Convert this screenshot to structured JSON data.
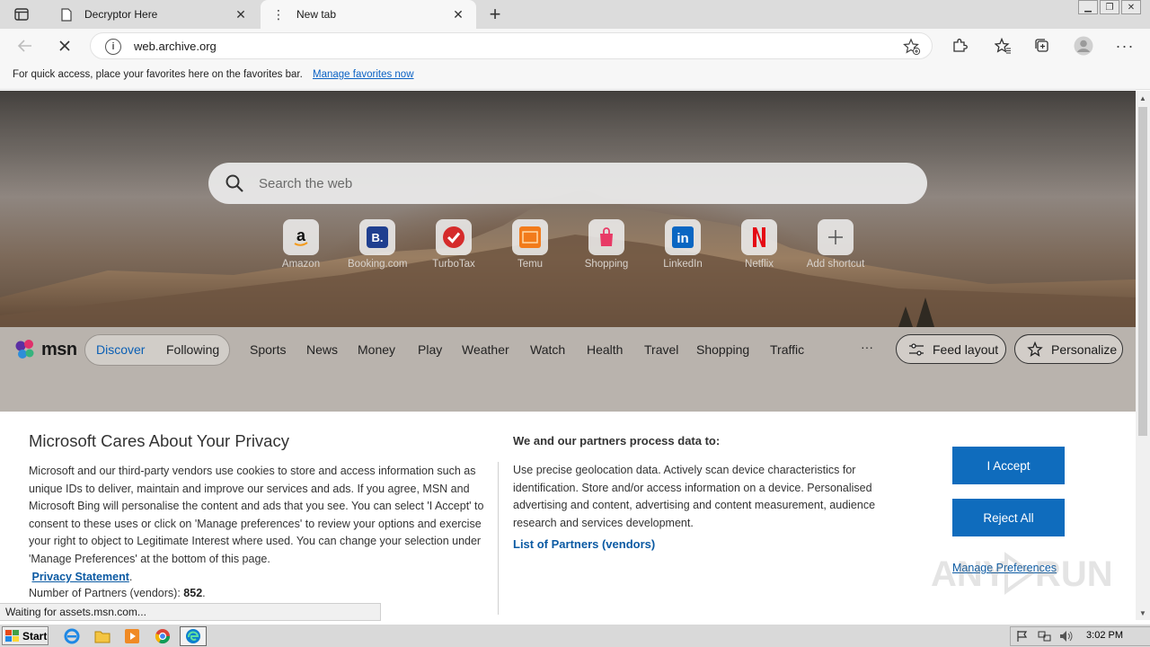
{
  "tabs": [
    {
      "title": "Decryptor Here",
      "active": false
    },
    {
      "title": "New tab",
      "active": true
    }
  ],
  "address": {
    "url": "web.archive.org"
  },
  "favorites_bar": {
    "hint": "For quick access, place your favorites here on the favorites bar.",
    "link": "Manage favorites now"
  },
  "search": {
    "placeholder": "Search the web"
  },
  "shortcuts": [
    {
      "label": "Amazon",
      "icon": "amazon-icon"
    },
    {
      "label": "Booking.com",
      "icon": "booking-icon"
    },
    {
      "label": "TurboTax",
      "icon": "turbotax-icon"
    },
    {
      "label": "Temu",
      "icon": "temu-icon"
    },
    {
      "label": "Shopping",
      "icon": "shopping-bag-icon"
    },
    {
      "label": "LinkedIn",
      "icon": "linkedin-icon"
    },
    {
      "label": "Netflix",
      "icon": "netflix-icon"
    },
    {
      "label": "Add shortcut",
      "icon": "plus-icon"
    }
  ],
  "msn": {
    "logo_text": "msn",
    "feed_tabs": [
      "Discover",
      "Following"
    ],
    "nav": [
      "Sports",
      "News",
      "Money",
      "Play",
      "Weather",
      "Watch",
      "Health",
      "Travel",
      "Shopping",
      "Traffic"
    ],
    "more": "···",
    "feed_layout": "Feed layout",
    "personalize": "Personalize"
  },
  "consent": {
    "title": "Microsoft Cares About Your Privacy",
    "body": "Microsoft and our third-party vendors use cookies to store and access information such as unique IDs to deliver, maintain and improve our services and ads. If you agree, MSN and Microsoft Bing will personalise the content and ads that you see. You can select 'I Accept' to consent to these uses or click on 'Manage preferences' to review your options and exercise your right to object to Legitimate Interest where used.  You can change your selection under 'Manage Preferences' at the bottom of this page.",
    "privacy_link": "Privacy Statement",
    "partners_label": "Number of Partners (vendors):",
    "partners_count": "852",
    "heading2": "We and our partners process data to:",
    "body2": "Use precise geolocation data. Actively scan device characteristics for identification. Store and/or access information on a device. Personalised advertising and content, advertising and content measurement, audience research and services development.",
    "vendors_link": "List of Partners (vendors)",
    "accept": "I Accept",
    "reject": "Reject All",
    "manage": "Manage Preferences"
  },
  "status_bar": "Waiting for assets.msn.com...",
  "taskbar": {
    "start": "Start",
    "clock": "3:02 PM"
  },
  "colors": {
    "accent": "#0f6cbd",
    "link": "#0b5aa3"
  }
}
